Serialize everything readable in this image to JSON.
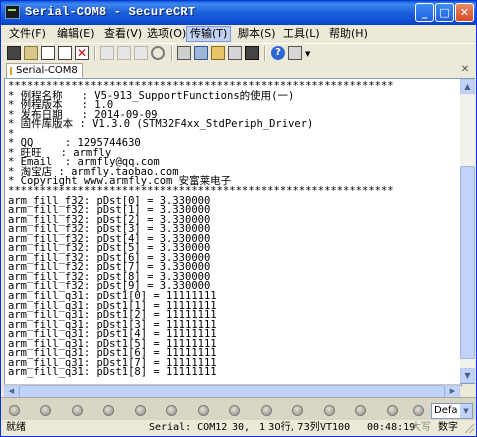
{
  "window": {
    "title": "Serial-COM8 - SecureCRT",
    "buttons": {
      "minimize": "_",
      "maximize": "□",
      "close": "✕"
    }
  },
  "menu": [
    "文件(F)",
    "编辑(E)",
    "查看(V)",
    "选项(O)",
    "传输(T)",
    "脚本(S)",
    "工具(L)",
    "帮助(H)"
  ],
  "toolbar_icons": [
    "connect-icon",
    "quick-connect-icon",
    "connect-tab-icon",
    "reconnect-icon",
    "disconnect-icon",
    "copy-icon",
    "paste-icon",
    "copy-paste-icon",
    "find-icon",
    "print-icon",
    "settings-icon",
    "session-options-icon",
    "keymap-icon",
    "sftp-icon",
    "help-icon",
    "keyboard-map-icon"
  ],
  "tab": {
    "label": "Serial-COM8"
  },
  "terminal": {
    "lines": [
      "*************************************************************",
      "* 例程名称   : V5-913_SupportFunctions的使用(一)",
      "* 例程版本   : 1.0",
      "* 发布日期   : 2014-09-09",
      "* 固件库版本 : V1.3.0 (STM32F4xx_StdPeriph_Driver)",
      "*",
      "* QQ     : 1295744630",
      "* 旺旺   : armfly",
      "* Email  : armfly@qq.com",
      "* 淘宝店 : armfly.taobao.com",
      "* Copyright www.armfly.com 安富莱电子",
      "*************************************************************",
      "arm_fill_f32: pDst[0] = 3.330000",
      "arm_fill_f32: pDst[1] = 3.330000",
      "arm_fill_f32: pDst[2] = 3.330000",
      "arm_fill_f32: pDst[3] = 3.330000",
      "arm_fill_f32: pDst[4] = 3.330000",
      "arm_fill_f32: pDst[5] = 3.330000",
      "arm_fill_f32: pDst[6] = 3.330000",
      "arm_fill_f32: pDst[7] = 3.330000",
      "arm_fill_f32: pDst[8] = 3.330000",
      "arm_fill_f32: pDst[9] = 3.330000",
      "arm_fill_q31: pDst1[0] = 11111111",
      "arm_fill_q31: pDst1[1] = 11111111",
      "arm_fill_q31: pDst1[2] = 11111111",
      "arm_fill_q31: pDst1[3] = 11111111",
      "arm_fill_q31: pDst1[4] = 11111111",
      "arm_fill_q31: pDst1[5] = 11111111",
      "arm_fill_q31: pDst1[6] = 11111111",
      "arm_fill_q31: pDst1[7] = 11111111",
      "arm_fill_q31: pDst1[8] = 11111111"
    ]
  },
  "button_bar": {
    "combo_value": "Defa"
  },
  "status": {
    "ready": "就绪",
    "port": "Serial: COM12",
    "row": "30,",
    "col": "1",
    "lines_cols": "30行, 73列",
    "emulation": "VT100",
    "time": "00:48:19",
    "caps": "大写",
    "num": "数字"
  },
  "colors": {
    "titlebar": "#0a5ad6",
    "terminal_bg": "#ffffff",
    "chrome": "#ece9d8",
    "active_menu": "#c1d2ee"
  }
}
